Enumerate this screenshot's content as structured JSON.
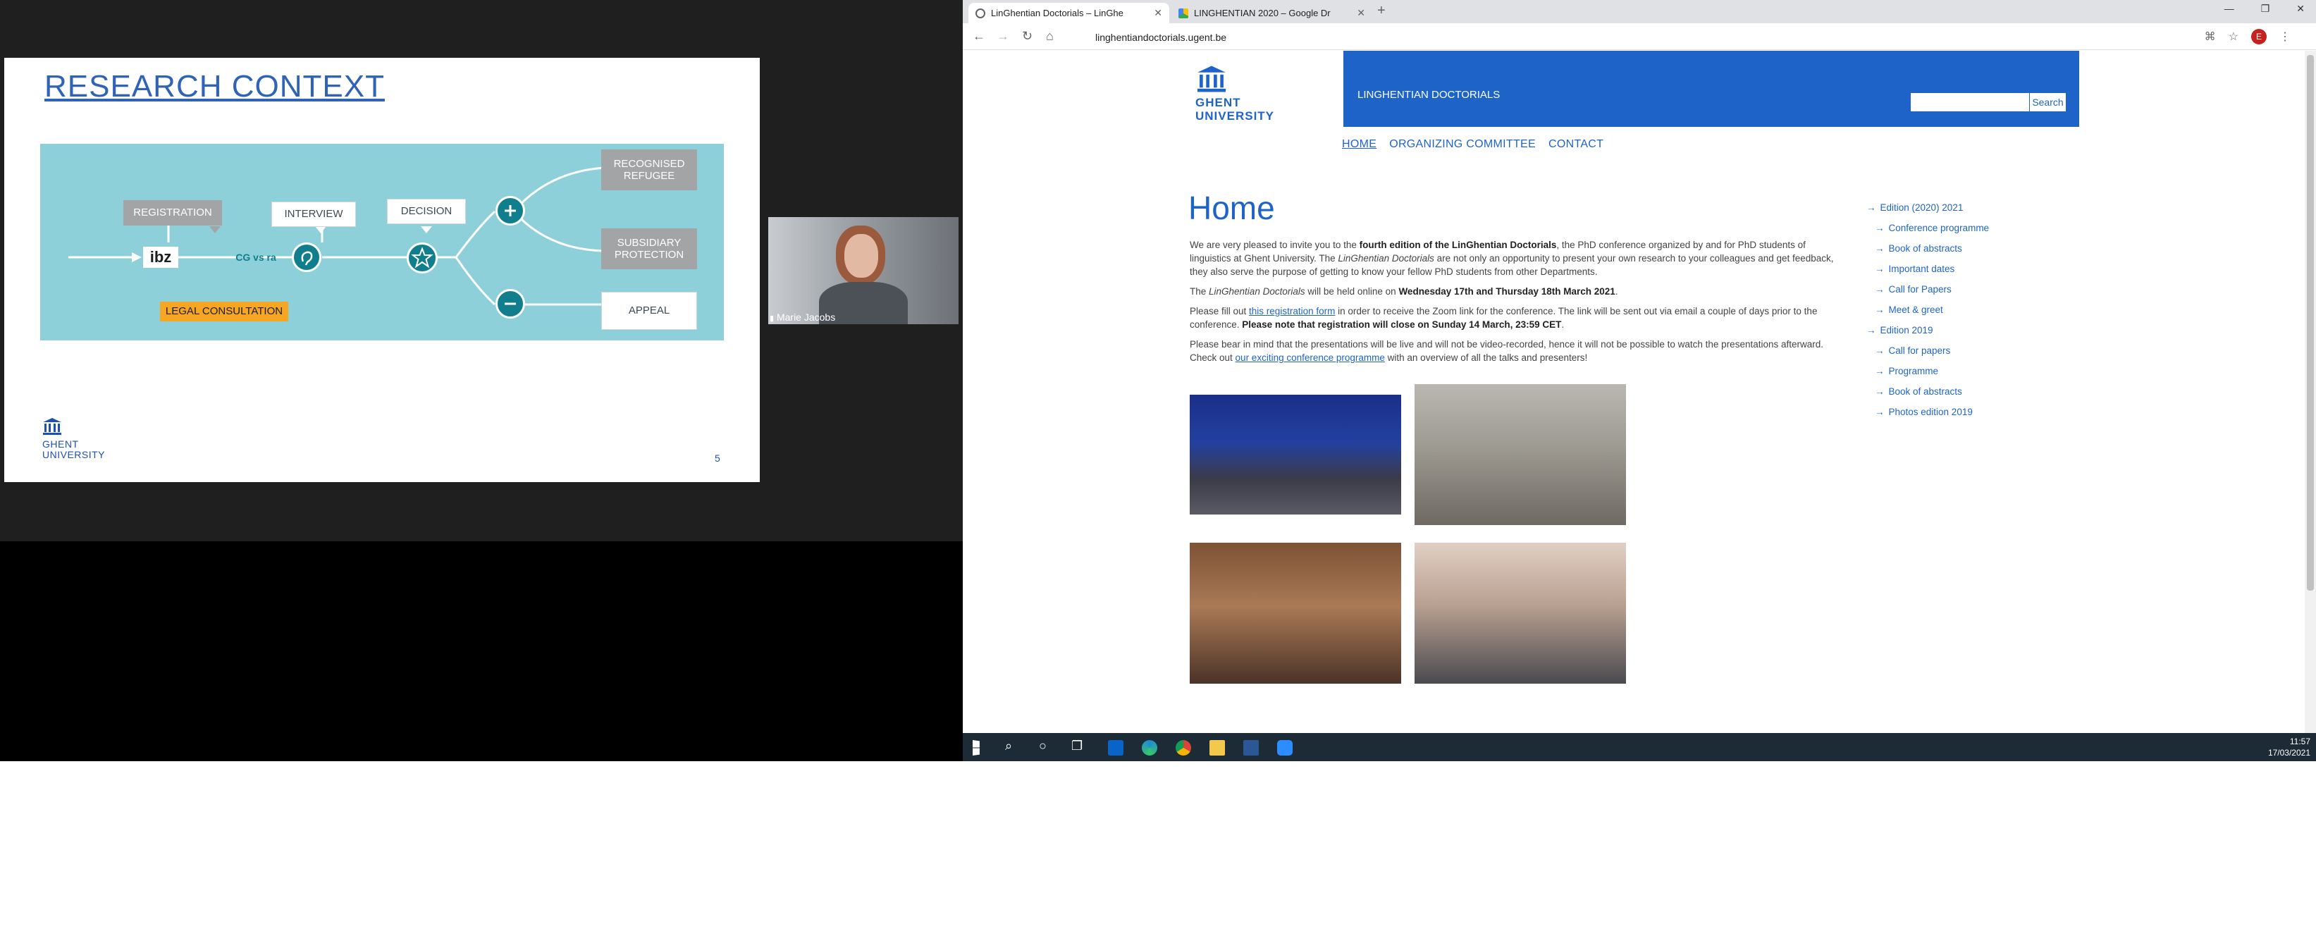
{
  "slide": {
    "title": "RESEARCH CONTEXT",
    "logo_line1": "GHENT",
    "logo_line2": "UNIVERSITY",
    "page_number": "5",
    "boxes": {
      "registration": "REGISTRATION",
      "interview": "INTERVIEW",
      "decision": "DECISION",
      "recognised_refugee": "RECOGNISED REFUGEE",
      "subsidiary_protection": "SUBSIDIARY PROTECTION",
      "appeal": "APPEAL",
      "legal_consultation": "LEGAL CONSULTATION",
      "ibz": "ibz",
      "cgvs": "CG vs ra"
    }
  },
  "video": {
    "participant_name": "Marie Jacobs"
  },
  "browser": {
    "tabs": [
      {
        "title": "LinGhentian Doctorials – LinGhe"
      },
      {
        "title": "LINGHENTIAN 2020 – Google Dr"
      }
    ],
    "new_tab_symbol": "+",
    "profile_initial": "E",
    "url": "linghentiandoctorials.ugent.be"
  },
  "site": {
    "logo_line1": "GHENT",
    "logo_line2": "UNIVERSITY",
    "name": "LINGHENTIAN DOCTORIALS",
    "search_label": "Search",
    "search_placeholder": "",
    "nav": [
      "HOME",
      "ORGANIZING COMMITTEE",
      "CONTACT"
    ],
    "page_title": "Home",
    "p1_a": "We are very pleased to invite you to the ",
    "p1_b": "fourth edition of the LinGhentian Doctorials",
    "p1_c": ", the PhD conference organized by and for PhD students of linguistics at Ghent University. The ",
    "p1_d": "LinGhentian Doctorials",
    "p1_e": " are not only an opportunity to present your own research to your colleagues and get feedback, they also serve the purpose of getting to know your fellow PhD students from other Departments.",
    "p2_a": "The ",
    "p2_b": "LinGhentian Doctorials",
    "p2_c": " will be held online on ",
    "p2_d": "Wednesday 17th and Thursday 18th March 2021",
    "p2_e": ".",
    "p3_a": "Please fill out ",
    "p3_link": "this registration form",
    "p3_b": " in order to receive the Zoom link for the conference. The link will be sent out via email a couple of days prior to the conference. ",
    "p3_c": "Please note that registration will close on Sunday 14 March, 23:59 CET",
    "p3_d": ".",
    "p4_a": "Please bear in mind that the presentations will be live and will not be video-recorded, hence it will not be possible to watch the presentations afterward. Check out ",
    "p4_link": "our exciting conference programme",
    "p4_b": " with an overview of all the talks and presenters!",
    "sidenav": [
      {
        "label": "Edition (2020) 2021",
        "level": 1
      },
      {
        "label": "Conference programme",
        "level": 2
      },
      {
        "label": "Book of abstracts",
        "level": 2
      },
      {
        "label": "Important dates",
        "level": 2
      },
      {
        "label": "Call for Papers",
        "level": 2
      },
      {
        "label": "Meet & greet",
        "level": 2
      },
      {
        "label": "Edition 2019",
        "level": 1
      },
      {
        "label": "Call for papers",
        "level": 2
      },
      {
        "label": "Programme",
        "level": 2
      },
      {
        "label": "Book of abstracts",
        "level": 2
      },
      {
        "label": "Photos edition 2019",
        "level": 2
      }
    ]
  },
  "taskbar": {
    "time": "11:57",
    "date": "17/03/2021"
  },
  "colors": {
    "ugent_blue": "#1e64c8",
    "diagram_bg": "#8ed0da",
    "teal": "#117e8e",
    "legal_orange": "#f6a623"
  }
}
